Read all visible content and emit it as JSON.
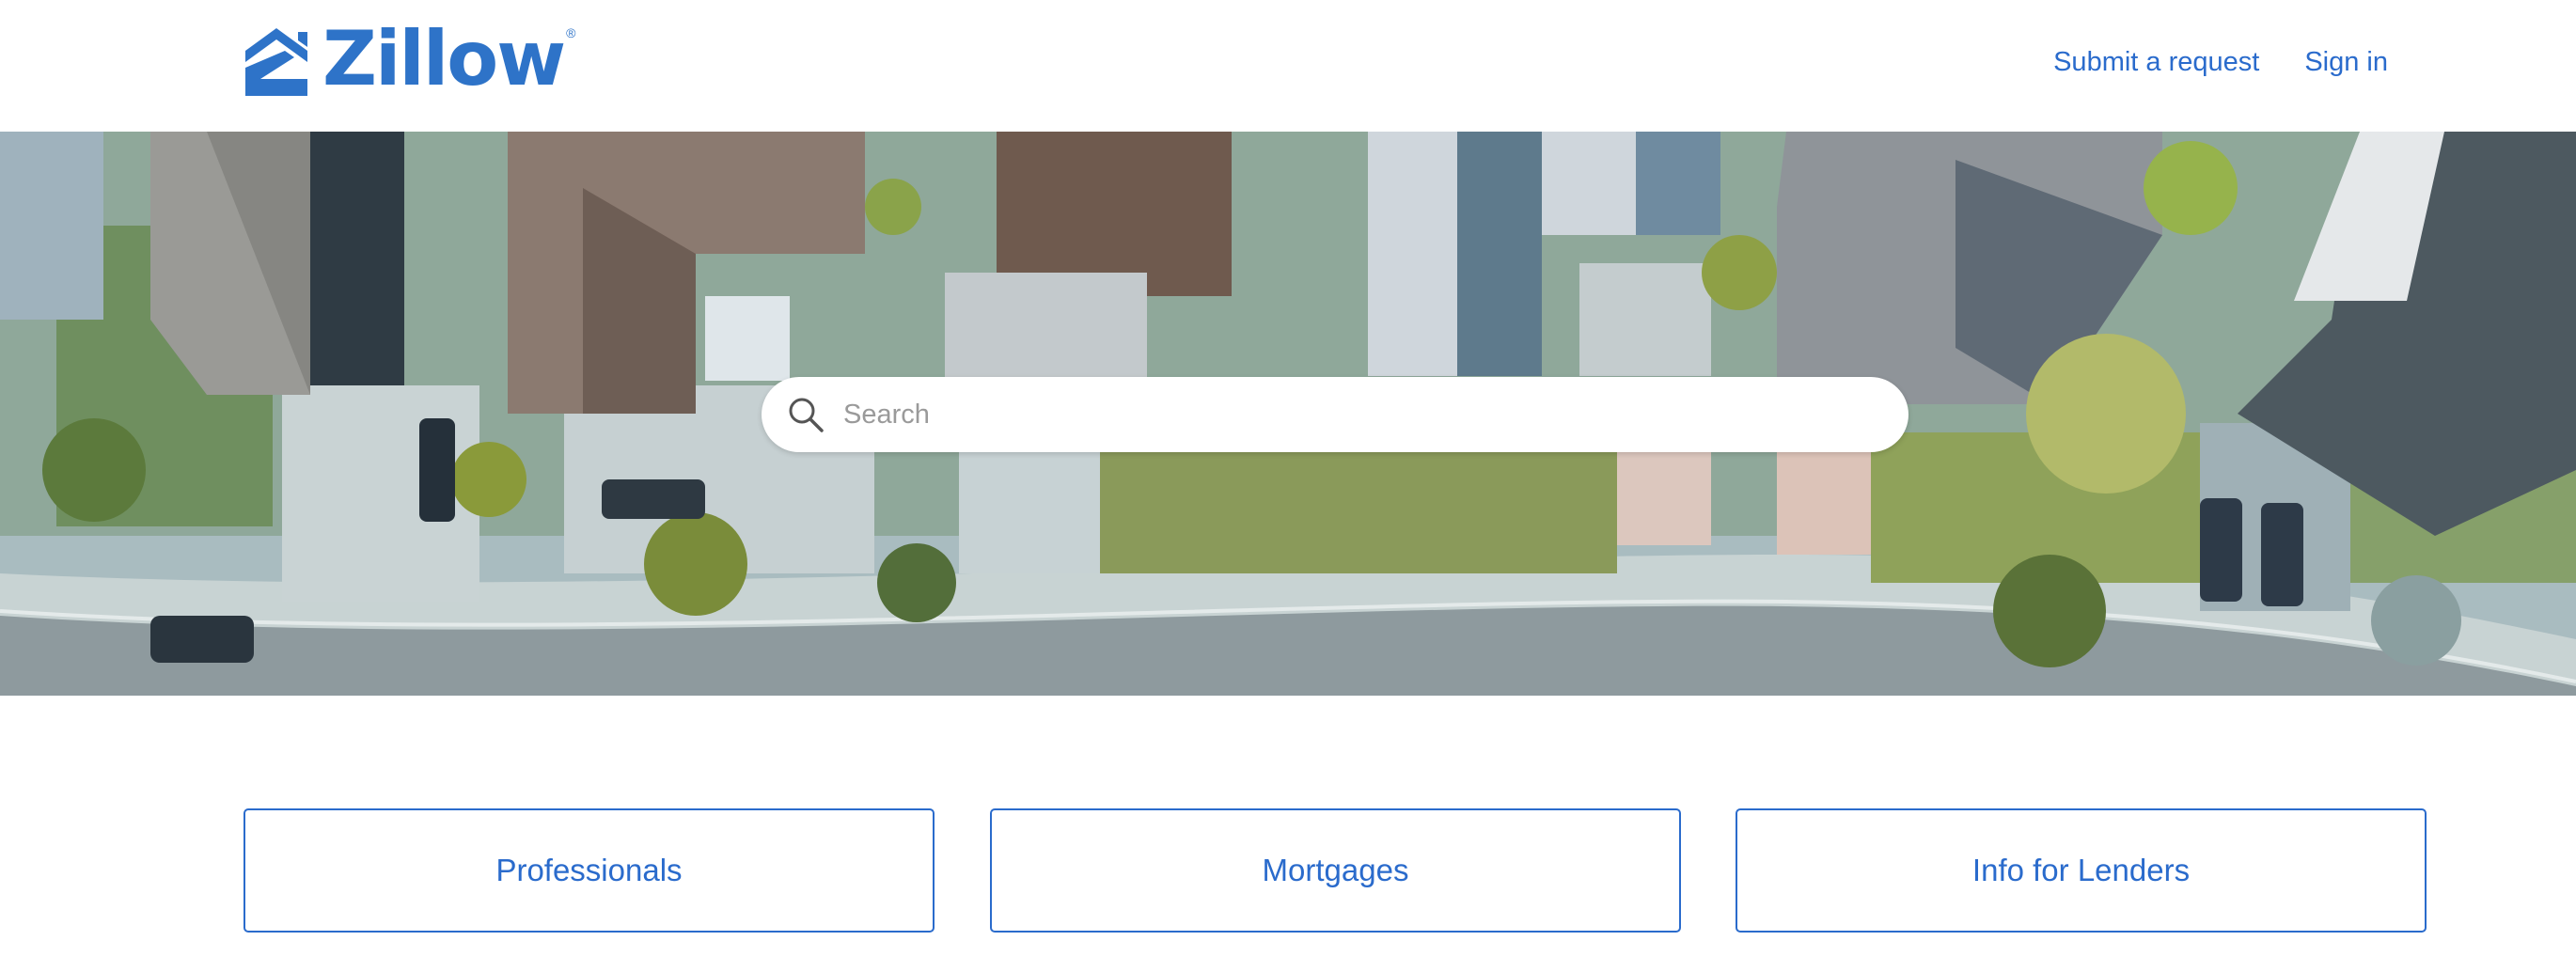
{
  "brand": {
    "name": "Zillow",
    "registered_mark": "®",
    "color": "#2e73c8"
  },
  "nav": {
    "submit_request": "Submit a request",
    "sign_in": "Sign in"
  },
  "hero": {
    "description_icon": "aerial-neighborhood-photo"
  },
  "search": {
    "placeholder": "Search",
    "value": "",
    "icon": "search-icon"
  },
  "categories": [
    {
      "label": "Professionals"
    },
    {
      "label": "Mortgages"
    },
    {
      "label": "Info for Lenders"
    }
  ],
  "colors": {
    "accent": "#2a6bcc",
    "background": "#ffffff"
  }
}
